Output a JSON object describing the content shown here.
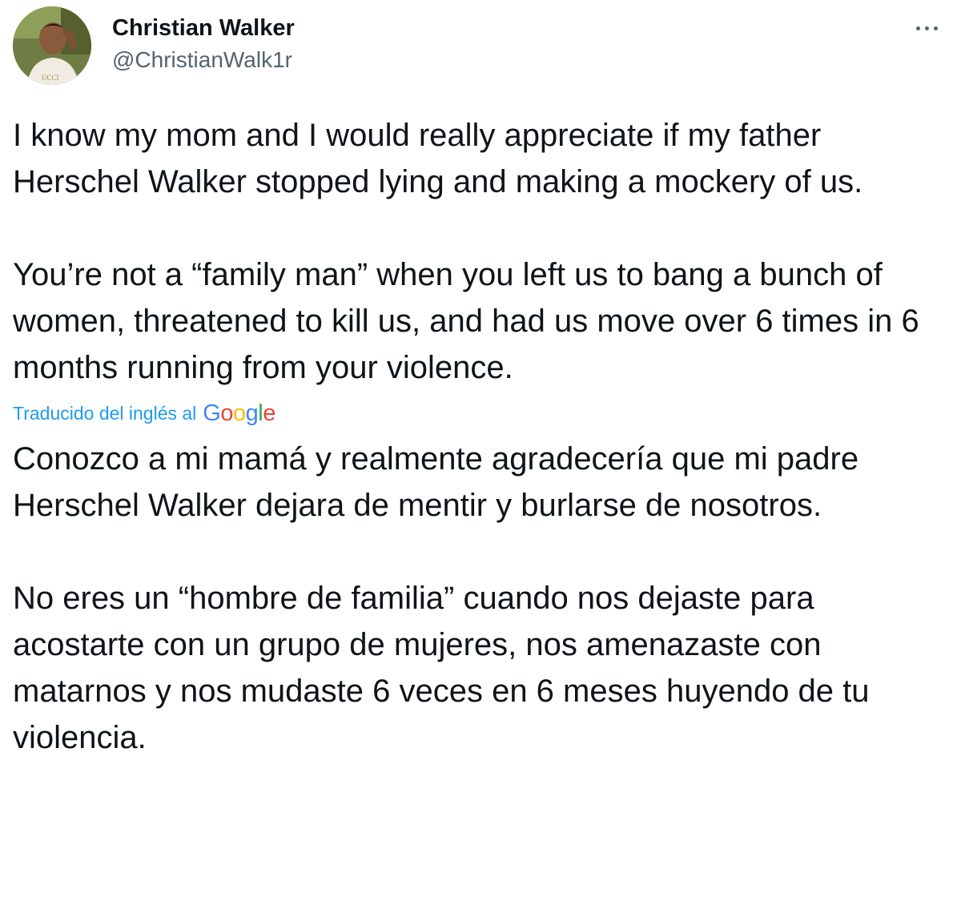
{
  "author": {
    "display_name": "Christian Walker",
    "handle": "@ChristianWalk1r"
  },
  "menu": {
    "more_icon": "ellipsis-icon"
  },
  "tweet": {
    "original_paragraphs": [
      "I know my mom and I would really appreciate if my father Herschel Walker stopped lying and making a mockery of us.",
      "You’re not a “family man” when you left us to bang a bunch of women, threatened to kill us, and had us move over 6 times in 6 months running from your violence."
    ],
    "translation_label": "Traducido del inglés al",
    "translation_provider": "Google",
    "translated_paragraphs": [
      "Conozco a mi mamá y realmente agradecería que mi padre Herschel Walker dejara de mentir y burlarse de nosotros.",
      "No eres un “hombre de familia” cuando nos dejaste para acostarte con un grupo de mujeres, nos amenazaste con matarnos y nos mudaste 6 veces en 6 meses huyendo de tu violencia."
    ]
  },
  "colors": {
    "text": "#0f1419",
    "secondary": "#536471",
    "link": "#1d9bf0"
  }
}
